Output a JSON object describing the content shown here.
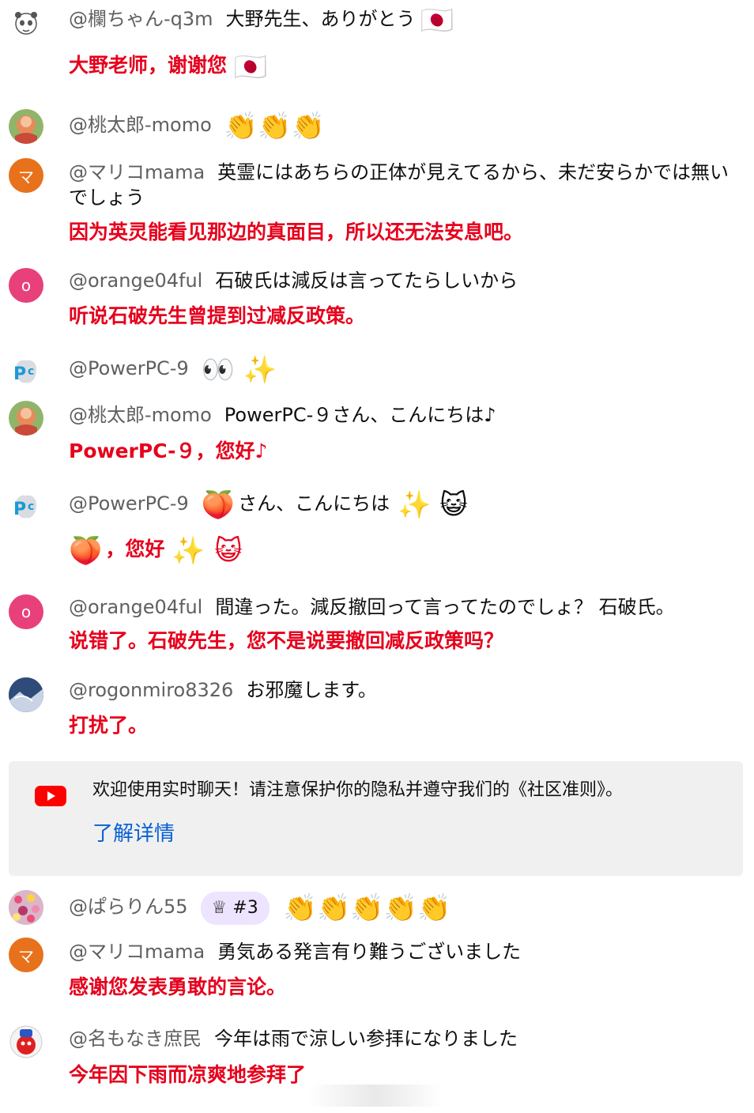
{
  "messages": [
    {
      "author": "@欄ちゃん-q3m",
      "text": "大野先生、ありがとう",
      "emoji": "🇯🇵",
      "translation": "大野老师，谢谢您",
      "translation_emoji": "🇯🇵"
    },
    {
      "author": "@桃太郎-momo",
      "emoji": "👏👏👏"
    },
    {
      "author": "@マリコmama",
      "avatar_letter": "マ",
      "text": "英霊にはあちらの正体が見えてるから、未だ安らかでは無いでしょう",
      "translation": "因为英灵能看见那边的真面目，所以还无法安息吧。"
    },
    {
      "author": "@orange04ful",
      "avatar_letter": "o",
      "text": "石破氏は減反は言ってたらしいから",
      "translation": "听说石破先生曾提到过减反政策。"
    },
    {
      "author": "@PowerPC-9",
      "emoji": "👀 ✨"
    },
    {
      "author": "@桃太郎-momo",
      "text": "PowerPC-９さん、こんにちは♪",
      "translation": "PowerPC-９，您好♪"
    },
    {
      "author": "@PowerPC-9",
      "emoji_pre": "🍑",
      "text": "さん、こんにちは",
      "emoji": "✨ 😺",
      "translation_emoji_pre": "🍑",
      "translation": "，您好",
      "translation_emoji": "✨ 😺"
    },
    {
      "author": "@orange04ful",
      "avatar_letter": "o",
      "text": "間違った。減反撤回って言ってたのでしょ？ 石破氏。",
      "translation": "说错了。石破先生，您不是说要撤回减反政策吗？"
    },
    {
      "author": "@rogonmiro8326",
      "text": "お邪魔します。",
      "translation": "打扰了。"
    },
    {
      "author": "@ぱらりん55",
      "badge": "#3",
      "emoji": "👏👏👏👏👏"
    },
    {
      "author": "@マリコmama",
      "avatar_letter": "マ",
      "text": "勇気ある発言有り難うございました",
      "translation": "感谢您发表勇敢的言论。"
    },
    {
      "author": "@名もなき庶民",
      "text": "今年は雨で涼しい参拝になりました",
      "translation": "今年因下雨而凉爽地参拜了"
    }
  ],
  "banner": {
    "text": "欢迎使用实时聊天！请注意保护你的隐私并遵守我们的《社区准则》。",
    "link": "了解详情"
  },
  "colors": {
    "translation": "#e6001c",
    "author": "#606060",
    "link": "#065fd4",
    "banner_bg": "#f0f0f0",
    "avatar_orange": "#e8711c",
    "avatar_pink": "#e8407a"
  }
}
